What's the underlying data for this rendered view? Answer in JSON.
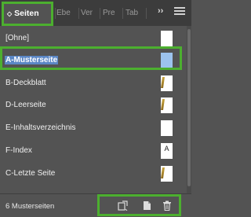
{
  "tabs": {
    "active": "Seiten",
    "others": [
      "Ebe",
      "Ver",
      "Pre",
      "Tab"
    ],
    "overflow": "››"
  },
  "pages": [
    {
      "label": "[Ohne]"
    },
    {
      "label": "A-Musterseite",
      "selected": true
    },
    {
      "label": "B-Deckblatt"
    },
    {
      "label": "D-Leerseite"
    },
    {
      "label": "E-Inhaltsverzeichnis"
    },
    {
      "label": "F-Index",
      "thumb_letter": "A"
    },
    {
      "label": "C-Letzte Seite"
    }
  ],
  "footer": {
    "count": "6 Musterseiten"
  },
  "colors": {
    "highlight": "#4caf2f",
    "selection": "#5b87c5"
  }
}
